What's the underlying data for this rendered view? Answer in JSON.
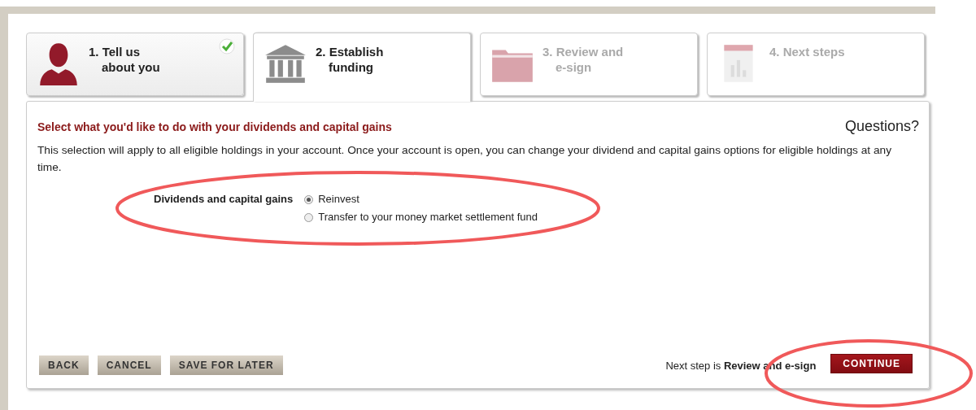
{
  "steps": [
    {
      "number": "1.",
      "title": "Tell us",
      "subtitle": "about you",
      "kind": "person",
      "selected": false,
      "completed": true,
      "disabled": false
    },
    {
      "number": "2.",
      "title": "Establish",
      "subtitle": "funding",
      "kind": "bank",
      "selected": true,
      "completed": false,
      "disabled": false
    },
    {
      "number": "3.",
      "title": "Review and",
      "subtitle": "e-sign",
      "kind": "folder",
      "selected": false,
      "completed": false,
      "disabled": true
    },
    {
      "number": "4.",
      "title": "Next steps",
      "kind": "chart",
      "selected": false,
      "completed": false,
      "disabled": true
    }
  ],
  "panel": {
    "heading": "Select what you'd like to do with your dividends and capital gains",
    "help_link": "Questions?",
    "description": "This selection will apply to all eligible holdings in your account. Once your account is open, you can change your dividend and capital gains options for eligible holdings at any time.",
    "field_label": "Dividends and capital gains",
    "options": [
      {
        "label": "Reinvest",
        "selected": true
      },
      {
        "label": "Transfer to your money market settlement fund",
        "selected": false
      }
    ]
  },
  "footer": {
    "buttons": [
      "BACK",
      "CANCEL",
      "SAVE FOR LATER"
    ],
    "next_step_note": "Next step is **Review and e-sign**",
    "continue_button": "CONTINUE"
  },
  "annotations": [
    {
      "kind": "ellipse"
    },
    {
      "kind": "ellipse"
    }
  ]
}
